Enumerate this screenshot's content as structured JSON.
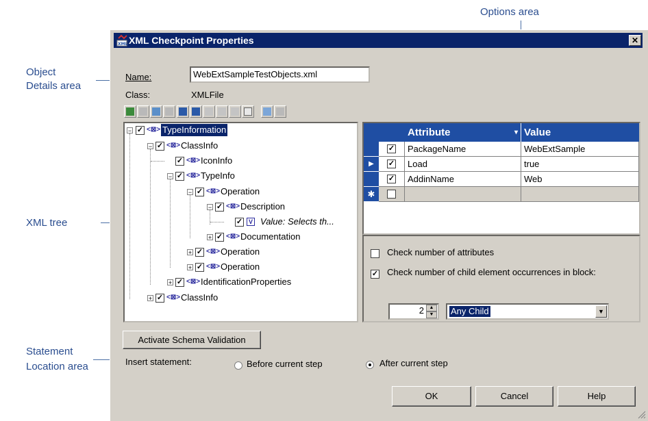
{
  "callouts": {
    "options_area": "Options area",
    "object_details_1": "Object",
    "object_details_2": "Details area",
    "xml_tree": "XML tree",
    "statement_1": "Statement",
    "statement_2": "Location area"
  },
  "dialog": {
    "title": "XML Checkpoint Properties",
    "close": "✕",
    "name_label": "Name:",
    "name_value": "WebExtSampleTestObjects.xml",
    "class_label": "Class:",
    "class_value": "XMLFile"
  },
  "tree": {
    "nodes": [
      {
        "label": "TypeInformation",
        "expander": "−"
      },
      {
        "label": "ClassInfo",
        "expander": "−"
      },
      {
        "label": "IconInfo",
        "expander": ""
      },
      {
        "label": "TypeInfo",
        "expander": "−"
      },
      {
        "label": "Operation",
        "expander": "−"
      },
      {
        "label": "Description",
        "expander": "−"
      },
      {
        "label": "Value: Selects th...",
        "expander": ""
      },
      {
        "label": "Documentation",
        "expander": "+"
      },
      {
        "label": "Operation",
        "expander": "+"
      },
      {
        "label": "Operation",
        "expander": "+"
      },
      {
        "label": "IdentificationProperties",
        "expander": "+"
      },
      {
        "label": "ClassInfo",
        "expander": "+"
      }
    ]
  },
  "grid": {
    "headers": {
      "attribute": "Attribute",
      "value": "Value"
    },
    "rows": [
      {
        "attribute": "PackageName",
        "value": "WebExtSample",
        "checked": "✓"
      },
      {
        "attribute": "Load",
        "value": "true",
        "checked": "✓"
      },
      {
        "attribute": "AddinName",
        "value": "Web",
        "checked": "✓"
      },
      {
        "attribute": "",
        "value": "",
        "checked": ""
      }
    ]
  },
  "options": {
    "check_attrs_label": "Check number of attributes",
    "check_child_label": "Check number of child element occurrences in block:",
    "occurrences_value": "2",
    "child_select": "Any Child"
  },
  "statement": {
    "activate_button": "Activate Schema Validation",
    "insert_label": "Insert statement:",
    "before_label": "Before current step",
    "after_label": "After current step"
  },
  "buttons": {
    "ok": "OK",
    "cancel": "Cancel",
    "help": "Help"
  },
  "colors": {
    "title_bar": "#0a246a",
    "grid_header": "#1f4ea3",
    "callout_text": "#2a4d8f"
  }
}
